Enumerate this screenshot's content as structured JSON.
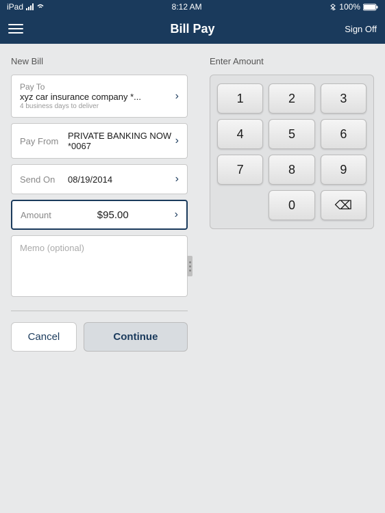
{
  "statusBar": {
    "carrier": "iPad",
    "time": "8:12 AM",
    "battery": "100%"
  },
  "navBar": {
    "title": "Bill Pay",
    "menuIcon": "menu",
    "signOffLabel": "Sign Off"
  },
  "leftPanel": {
    "sectionLabel": "New Bill",
    "payToField": {
      "label": "Pay To",
      "value": "xyz car insurance company *...",
      "subLabel": "4 business days to deliver"
    },
    "payFromField": {
      "label": "Pay From",
      "value": "PRIVATE BANKING NOW *0067"
    },
    "sendOnField": {
      "label": "Send On",
      "value": "08/19/2014"
    },
    "amountField": {
      "label": "Amount",
      "value": "$95.00"
    },
    "memoPlaceholder": "Memo (optional)",
    "cancelLabel": "Cancel",
    "continueLabel": "Continue"
  },
  "rightPanel": {
    "sectionLabel": "Enter Amount",
    "numpad": {
      "keys": [
        "1",
        "2",
        "3",
        "4",
        "5",
        "6",
        "7",
        "8",
        "9",
        "",
        "0",
        "⌫"
      ]
    }
  }
}
